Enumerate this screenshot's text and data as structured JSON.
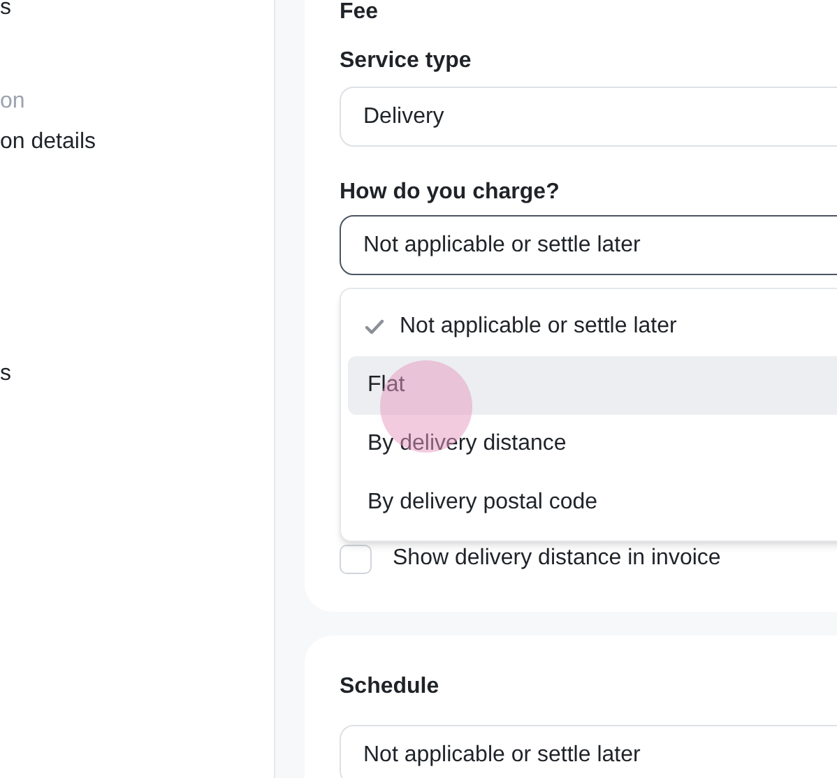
{
  "sidebar": {
    "items": [
      {
        "label": "s",
        "muted": false
      },
      {
        "label": "on",
        "muted": true
      },
      {
        "label": "on details",
        "muted": false
      },
      {
        "label": "s",
        "muted": false
      }
    ]
  },
  "fee_card": {
    "title": "Fee",
    "service_type": {
      "label": "Service type",
      "value": "Delivery",
      "open": false
    },
    "charge": {
      "label": "How do you charge?",
      "value": "Not applicable or settle later",
      "open": true,
      "options": [
        {
          "label": "Not applicable or settle later",
          "selected": true,
          "highlighted": false
        },
        {
          "label": "Flat",
          "selected": false,
          "highlighted": true
        },
        {
          "label": "By delivery distance",
          "selected": false,
          "highlighted": false
        },
        {
          "label": "By delivery postal code",
          "selected": false,
          "highlighted": false
        }
      ]
    },
    "show_distance": {
      "label": "Show delivery distance in invoice",
      "checked": false
    }
  },
  "schedule_card": {
    "title": "Schedule",
    "value": "Not applicable or settle later",
    "open": false
  }
}
